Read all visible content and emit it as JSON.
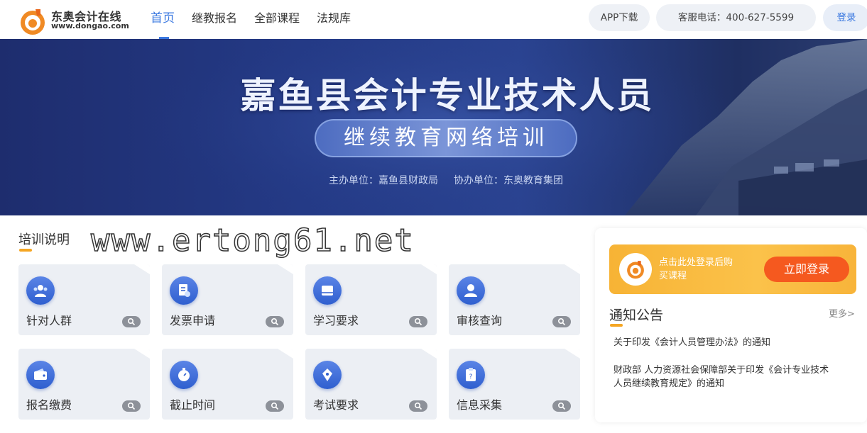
{
  "header": {
    "logo": {
      "name_cn": "东奥会计在线",
      "name_en": "www.dongao.com"
    },
    "nav": [
      {
        "label": "首页",
        "active": true
      },
      {
        "label": "继教报名",
        "active": false
      },
      {
        "label": "全部课程",
        "active": false
      },
      {
        "label": "法规库",
        "active": false
      }
    ],
    "app_download": "APP下载",
    "phone": "客服电话：400-627-5599",
    "login": "登录"
  },
  "banner": {
    "title": "嘉鱼县会计专业技术人员",
    "subtitle": "继续教育网络培训",
    "host": "主办单位：嘉鱼县财政局",
    "co_host": "协办单位：东奥教育集团"
  },
  "watermark": "www.ertong61.net",
  "training": {
    "title": "培训说明",
    "cards": [
      {
        "label": "针对人群",
        "icon": "people-icon"
      },
      {
        "label": "发票申请",
        "icon": "invoice-icon"
      },
      {
        "label": "学习要求",
        "icon": "book-icon"
      },
      {
        "label": "审核查询",
        "icon": "user-check-icon"
      },
      {
        "label": "报名缴费",
        "icon": "wallet-icon"
      },
      {
        "label": "截止时间",
        "icon": "stopwatch-icon"
      },
      {
        "label": "考试要求",
        "icon": "pen-icon"
      },
      {
        "label": "信息采集",
        "icon": "clipboard-icon"
      }
    ]
  },
  "login_banner": {
    "text": "点击此处登录后购买课程",
    "button": "立即登录"
  },
  "notice": {
    "title": "通知公告",
    "more": "更多>",
    "items": [
      "关于印发《会计人员管理办法》的通知",
      "财政部 人力资源社会保障部关于印发《会计专业技术人员继续教育规定》的通知"
    ]
  },
  "colors": {
    "accent": "#3a78e0",
    "orange": "#f5591f",
    "yellow": "#f7b335",
    "underline": "#f5a623",
    "banner_bg": "#243a86"
  }
}
